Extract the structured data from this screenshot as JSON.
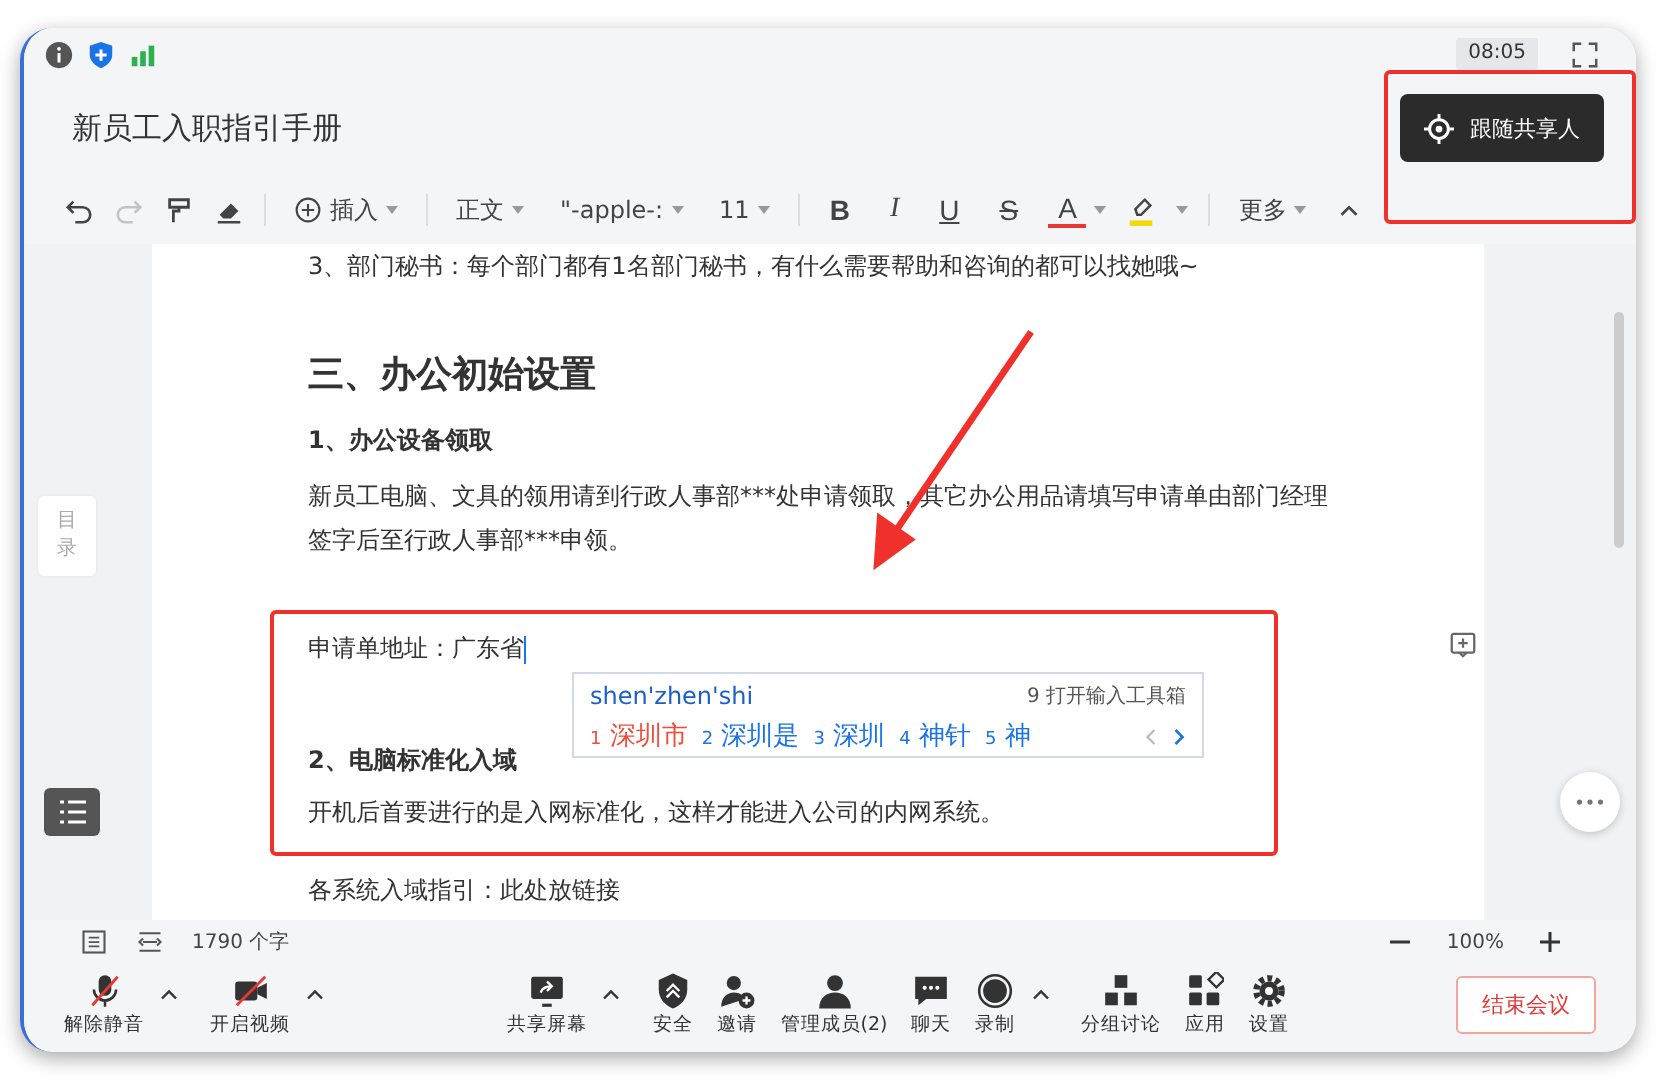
{
  "status_bar": {
    "time": "08:05"
  },
  "title": "新员工入职指引手册",
  "follow_button": {
    "label": "跟随共享人"
  },
  "toolbar": [
    {
      "kind": "undo",
      "disabled": false
    },
    {
      "kind": "redo",
      "disabled": true
    },
    {
      "kind": "painter"
    },
    {
      "kind": "eraser"
    },
    {
      "kind": "sep"
    },
    {
      "kind": "insert",
      "label": "插入"
    },
    {
      "kind": "sep"
    },
    {
      "kind": "dropdown",
      "label": "正文"
    },
    {
      "kind": "dropdown",
      "label": "\"-apple-:"
    },
    {
      "kind": "dropdown",
      "label": "11"
    },
    {
      "kind": "sep"
    },
    {
      "kind": "bold",
      "label": "B"
    },
    {
      "kind": "italic",
      "label": "I"
    },
    {
      "kind": "underline",
      "label": "U"
    },
    {
      "kind": "strike",
      "label": "S"
    },
    {
      "kind": "fontcolor",
      "label": "A",
      "color": "#e53935"
    },
    {
      "kind": "highlight",
      "color": "#f5d90a"
    },
    {
      "kind": "sep"
    },
    {
      "kind": "more",
      "label": "更多"
    },
    {
      "kind": "collapse"
    }
  ],
  "document": {
    "blocks": [
      {
        "kind": "para",
        "text": "3、部门秘书：每个部门都有1名部门秘书，有什么需要帮助和咨询的都可以找她哦~"
      },
      {
        "kind": "h1",
        "text": "三、办公初始设置"
      },
      {
        "kind": "h2",
        "text": "1、办公设备领取"
      },
      {
        "kind": "para",
        "text": "新员工电脑、文具的领用请到行政人事部***处申请领取，其它办公用品请填写申请单由部门经理签字后至行政人事部***申领。"
      },
      {
        "kind": "frame",
        "blocks": [
          {
            "kind": "para",
            "text": "申请单地址：广东省",
            "cursor": true
          },
          {
            "kind": "h2",
            "text": "2、电脑标准化入域"
          },
          {
            "kind": "para",
            "text": "开机后首要进行的是入网标准化，这样才能进入公司的内网系统。"
          }
        ]
      },
      {
        "kind": "para",
        "text": "各系统入域指引：此处放链接"
      }
    ]
  },
  "outline_tab": {
    "label": "目录"
  },
  "ime": {
    "input": "shen'zhen'shi",
    "toolbox": "9 打开输入工具箱",
    "candidates": [
      {
        "index": "1",
        "text": "深圳市",
        "selected": true
      },
      {
        "index": "2",
        "text": "深圳是",
        "selected": false
      },
      {
        "index": "3",
        "text": "深圳",
        "selected": false
      },
      {
        "index": "4",
        "text": "神针",
        "selected": false
      },
      {
        "index": "5",
        "text": "神",
        "selected": false
      }
    ]
  },
  "footer": {
    "word_count": "1790 个字",
    "zoom": "100%"
  },
  "meeting_bar": [
    {
      "kind": "mic",
      "label": "解除静音",
      "off": true,
      "caret": true
    },
    {
      "kind": "video",
      "label": "开启视频",
      "off": true,
      "caret": true
    },
    {
      "kind": "gap"
    },
    {
      "kind": "share",
      "label": "共享屏幕",
      "caret": true
    },
    {
      "kind": "security",
      "label": "安全"
    },
    {
      "kind": "invite",
      "label": "邀请"
    },
    {
      "kind": "members",
      "label": "管理成员(2)"
    },
    {
      "kind": "chat",
      "label": "聊天"
    },
    {
      "kind": "record",
      "label": "录制",
      "caret": true
    },
    {
      "kind": "breakout",
      "label": "分组讨论"
    },
    {
      "kind": "apps",
      "label": "应用"
    },
    {
      "kind": "settings",
      "label": "设置"
    }
  ],
  "end_button": {
    "label": "结束会议"
  }
}
